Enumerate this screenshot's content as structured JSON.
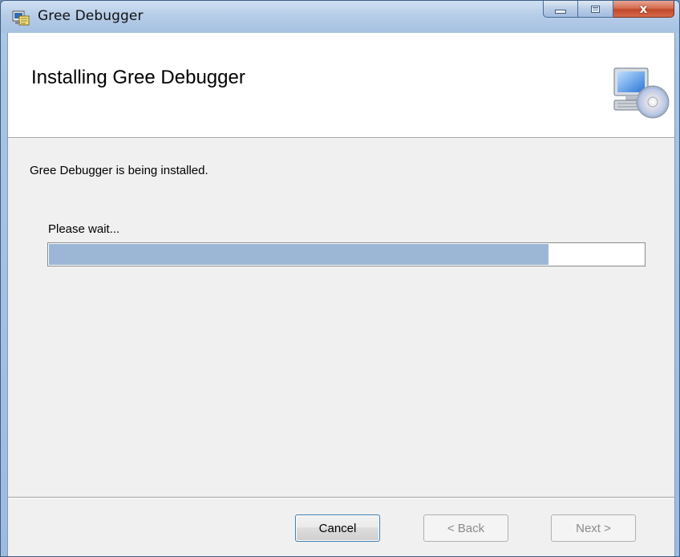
{
  "window": {
    "title": "Gree Debugger",
    "controls": {
      "minimize": "minimize",
      "maximize": "maximize",
      "close": "x"
    }
  },
  "header": {
    "heading": "Installing Gree Debugger",
    "icon": "computer-cd-install-icon"
  },
  "body": {
    "status": "Gree Debugger is being installed.",
    "wait_label": "Please wait...",
    "progress_fraction": 0.84
  },
  "footer": {
    "cancel_label": "Cancel",
    "back_label": "< Back",
    "next_label": "Next >"
  },
  "colors": {
    "progress_fill": "#9cb7d6",
    "titlebar": "#b6cde8",
    "close_button": "#c2492b"
  }
}
